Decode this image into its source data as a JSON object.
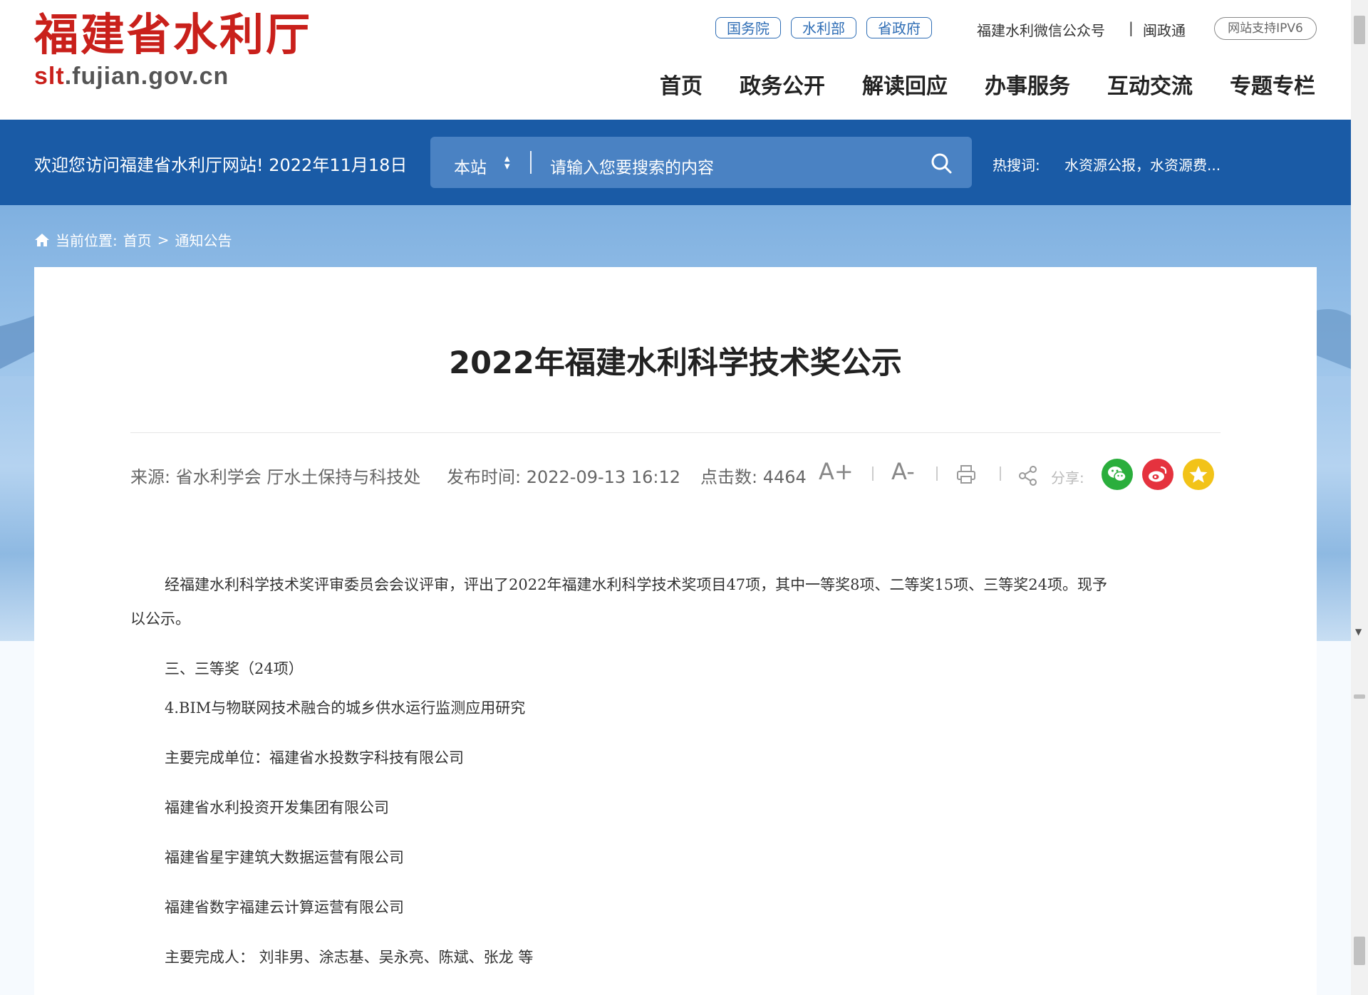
{
  "header": {
    "logo_cn": "福建省水利厅",
    "logo_en_red": "slt",
    "logo_en_rest": ".fujian.gov.cn",
    "top_links": [
      "国务院",
      "水利部",
      "省政府"
    ],
    "wechat": "福建水利微信公众号",
    "separator": "|",
    "minzheng": "闽政通",
    "ipv6": "网站支持IPV6",
    "nav": [
      "首页",
      "政务公开",
      "解读回应",
      "办事服务",
      "互动交流",
      "专题专栏"
    ]
  },
  "bluebar": {
    "welcome": "欢迎您访问福建省水利厅网站! 2022年11月18日",
    "scope": "本站",
    "placeholder": "请输入您要搜索的内容",
    "hot_label": "热搜词:",
    "hot_terms": "水资源公报，水资源费..."
  },
  "breadcrumb": {
    "label": "当前位置:",
    "home": "首页",
    "sep": ">",
    "current": "通知公告"
  },
  "article": {
    "title": "2022年福建水利科学技术奖公示",
    "source": "来源:  省水利学会 厅水土保持与科技处",
    "published": "发布时间:  2022-09-13 16:12",
    "hits": "点击数:  4464",
    "font_up": "A+",
    "font_down": "A-",
    "share_label": "分享:",
    "paragraphs": [
      "经福建水利科学技术奖评审委员会会议评审，评出了2022年福建水利科学技术奖项目47项，其中一等奖8项、二等奖15项、三等奖24项。现予",
      "以公示。",
      "三、三等奖（24项）",
      "4.BIM与物联网技术融合的城乡供水运行监测应用研究",
      "主要完成单位：福建省水投数字科技有限公司",
      "福建省水利投资开发集团有限公司",
      "福建省星宇建筑大数据运营有限公司",
      "福建省数字福建云计算运营有限公司",
      "主要完成人：  刘非男、涂志基、吴永亮、陈斌、张龙 等"
    ]
  },
  "colors": {
    "brand_red": "#c9201b",
    "brand_blue": "#1a5ba6",
    "search_blue": "#4a82c3",
    "wechat_green": "#2aae3c",
    "weibo_red": "#e5323e",
    "favorite_yellow": "#f2c318"
  },
  "icons": [
    "home-icon",
    "sort-updown-icon",
    "search-icon",
    "print-icon",
    "share-icon",
    "wechat-icon",
    "weibo-icon",
    "star-icon"
  ]
}
